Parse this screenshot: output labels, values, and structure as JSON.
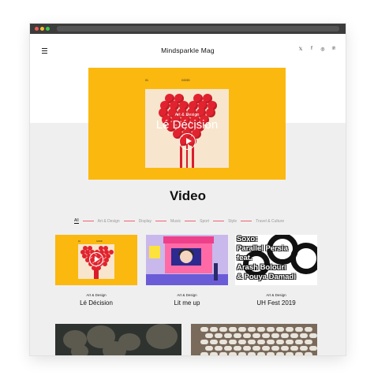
{
  "site": {
    "title": "Mindsparkle Mag"
  },
  "social": [
    "twitter-icon",
    "facebook-icon",
    "instagram-icon",
    "pinterest-icon"
  ],
  "social_glyphs": [
    "𝕏",
    "f",
    "◎",
    "℗"
  ],
  "hero": {
    "tag_left": "01",
    "tag_right": "GOOD",
    "category": "Art & Design",
    "title": "Lé Décision"
  },
  "section": {
    "title": "Video"
  },
  "filters": [
    {
      "label": "All",
      "active": true
    },
    {
      "label": "Art & Design",
      "active": false
    },
    {
      "label": "Display",
      "active": false
    },
    {
      "label": "Music",
      "active": false
    },
    {
      "label": "Sport",
      "active": false
    },
    {
      "label": "Style",
      "active": false
    },
    {
      "label": "Travel & Culture",
      "active": false
    }
  ],
  "cards": [
    {
      "category": "Art & Design",
      "title": "Lé Décision"
    },
    {
      "category": "Art & Design",
      "title": "Lit me up"
    },
    {
      "category": "Art & Design",
      "title": "UH Fest 2019"
    }
  ],
  "card3_art_lines": [
    "Soxo:",
    "Parallel Persia",
    "feat.",
    "Arash Bolouri",
    "& Pouya Damadi"
  ],
  "colors": {
    "accent": "#fbb80f",
    "red": "#e2232f",
    "filter_separator": "#f06070"
  }
}
